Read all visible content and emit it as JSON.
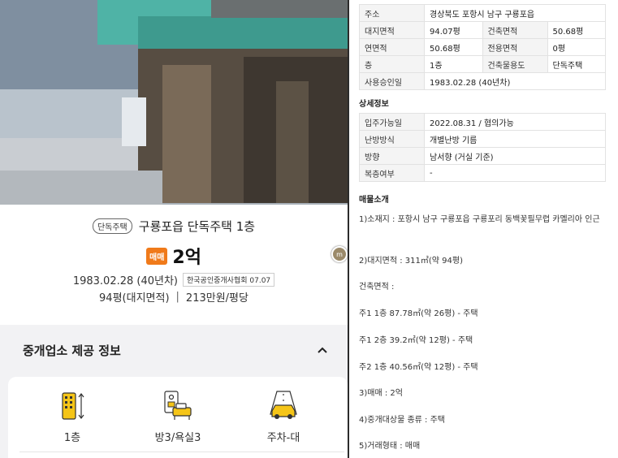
{
  "listing": {
    "type_badge": "단독주택",
    "title": "구룡포읍 단독주택 1층",
    "trade_badge": "매매",
    "price": "2억",
    "built": "1983.02.28 (40년차)",
    "association": "한국공인중개사협회 07.07",
    "land_area": "94평(대지면적)",
    "separator": "|",
    "price_per_pyeong": "213만원/평당"
  },
  "side_button": {
    "label": "m"
  },
  "agency": {
    "title": "중개업소 제공 정보",
    "features": [
      {
        "icon": "building-floor-icon",
        "label": "1층"
      },
      {
        "icon": "room-bath-icon",
        "label": "방3/욕실3"
      },
      {
        "icon": "parking-car-icon",
        "label": "주차-대"
      }
    ]
  },
  "basic_info": [
    {
      "label": "주소",
      "value": "경상북도 포항시 남구 구룡포읍"
    },
    {
      "label": "대지면적",
      "value": "94.07평",
      "label2": "건축면적",
      "value2": "50.68평"
    },
    {
      "label": "연면적",
      "value": "50.68평",
      "label2": "전용면적",
      "value2": "0평"
    },
    {
      "label": "층",
      "value": "1층",
      "label2": "건축물용도",
      "value2": "단독주택"
    },
    {
      "label": "사용승인일",
      "value": "1983.02.28 (40년차)"
    }
  ],
  "detail": {
    "title": "상세정보",
    "rows": [
      {
        "label": "입주가능일",
        "value": "2022.08.31 / 협의가능"
      },
      {
        "label": "난방방식",
        "value": "개별난방 기름"
      },
      {
        "label": "방향",
        "value": "남서향 (거실 기준)"
      },
      {
        "label": "복층여부",
        "value": "-"
      }
    ]
  },
  "intro": {
    "title": "매물소개",
    "lines": [
      "1)소재지 : 포항시 남구 구룡포읍 구룡포리 동백꽃필무렵 카멜리아 인근",
      "2)대지면적 : 311㎡(약 94평)",
      "건축면적 :",
      "주1 1층 87.78㎡(약 26평) - 주택",
      "주1 2층 39.2㎡(약 12평) - 주택",
      "주2 1층 40.56㎡(약 12평) - 주택",
      "3)매매 : 2억",
      "4)중개대상물 종류 : 주택",
      "5)거래형태 : 매매"
    ]
  },
  "colors": {
    "accent_orange": "#f07a1a",
    "icon_yellow": "#f5c518"
  }
}
